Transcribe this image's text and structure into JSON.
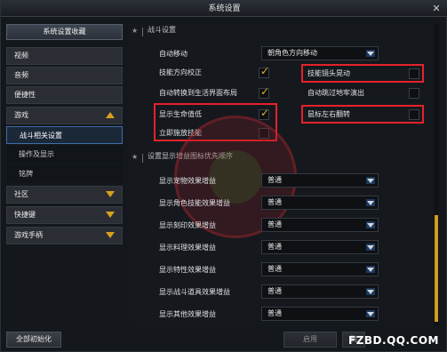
{
  "window": {
    "title": "系统设置"
  },
  "sidebar": {
    "header": "系统设置收藏",
    "items": [
      {
        "label": "视频"
      },
      {
        "label": "音频"
      },
      {
        "label": "便捷性"
      },
      {
        "label": "游戏"
      },
      {
        "label": "社区"
      },
      {
        "label": "快捷键"
      },
      {
        "label": "游戏手柄"
      }
    ],
    "game_subitems": [
      {
        "label": "战斗相关设置"
      },
      {
        "label": "操作及显示"
      },
      {
        "label": "铭牌"
      }
    ],
    "reset_label": "全部初始化"
  },
  "combat": {
    "section_title": "战斗设置",
    "auto_move_label": "自动移动",
    "auto_move_value": "朝角色方向移动",
    "skill_dir_label": "技能方向校正",
    "camera_shake_label": "技能镜头晃动",
    "auto_switch_label": "自动转换到生活界面布局",
    "skip_cutscene_label": "自动跳过地牢演出",
    "show_hp_label": "显示生命值低",
    "mouse_flip_label": "鼠标左右翻转",
    "instant_cast_label": "立即施放技能",
    "check_glyph": "✓"
  },
  "buff": {
    "section_title": "设置显示增益图标优先顺序",
    "rows": [
      {
        "label": "显示宠物效果增益",
        "value": "普通"
      },
      {
        "label": "显示角色技能效果增益",
        "value": "普通"
      },
      {
        "label": "显示刻印效果增益",
        "value": "普通"
      },
      {
        "label": "显示料理效果增益",
        "value": "普通"
      },
      {
        "label": "显示特性效果增益",
        "value": "普通"
      },
      {
        "label": "显示战斗道具效果增益",
        "value": "普通"
      },
      {
        "label": "显示其他效果增益",
        "value": "普通"
      }
    ]
  },
  "footer": {
    "apply_label": "启用",
    "confirm_label": "确"
  },
  "brand": "FZBD.QQ.COM",
  "colors": {
    "accent": "#d7a11c",
    "highlight": "#e5222a",
    "active_border": "#3d6ea8"
  }
}
